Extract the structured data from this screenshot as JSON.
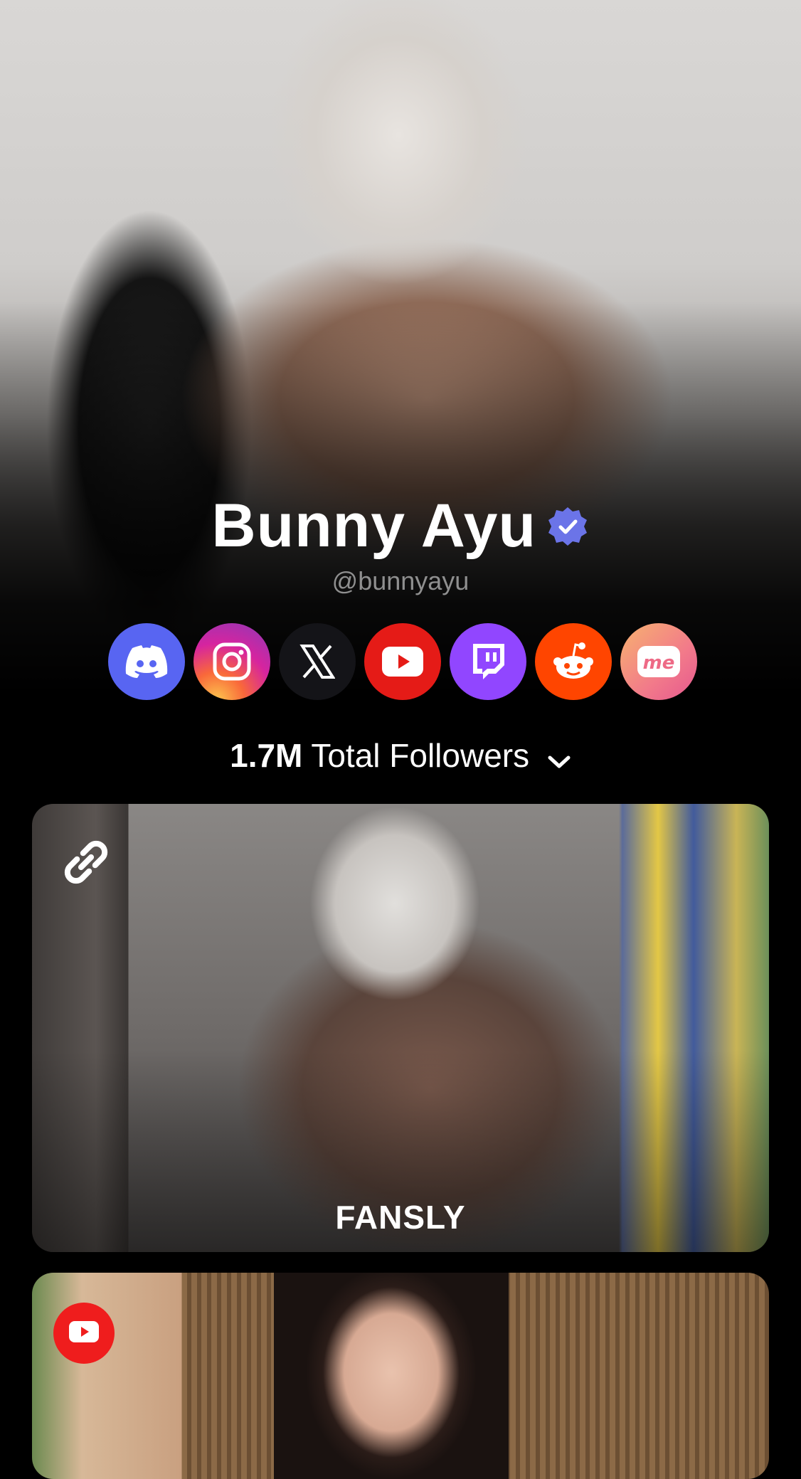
{
  "profile": {
    "name": "Bunny Ayu",
    "handle": "@bunnyayu",
    "verified_icon": "verified-badge-icon"
  },
  "socials": [
    {
      "name": "discord",
      "icon": "discord-icon",
      "color": "#5865F2"
    },
    {
      "name": "instagram",
      "icon": "instagram-icon",
      "color": "#E1306C"
    },
    {
      "name": "x",
      "icon": "x-icon",
      "color": "#141414"
    },
    {
      "name": "youtube",
      "icon": "youtube-icon",
      "color": "#E51B17"
    },
    {
      "name": "twitch",
      "icon": "twitch-icon",
      "color": "#9146FF"
    },
    {
      "name": "reddit",
      "icon": "reddit-icon",
      "color": "#FF4500"
    },
    {
      "name": "throne",
      "icon": "me-icon",
      "color": "#F27A8A"
    }
  ],
  "followers": {
    "count": "1.7M",
    "label": "Total Followers",
    "icon": "chevron-down-icon"
  },
  "cards": [
    {
      "title": "FANSLY",
      "icon": "link-icon"
    },
    {
      "title": "",
      "icon": "youtube-icon"
    }
  ]
}
